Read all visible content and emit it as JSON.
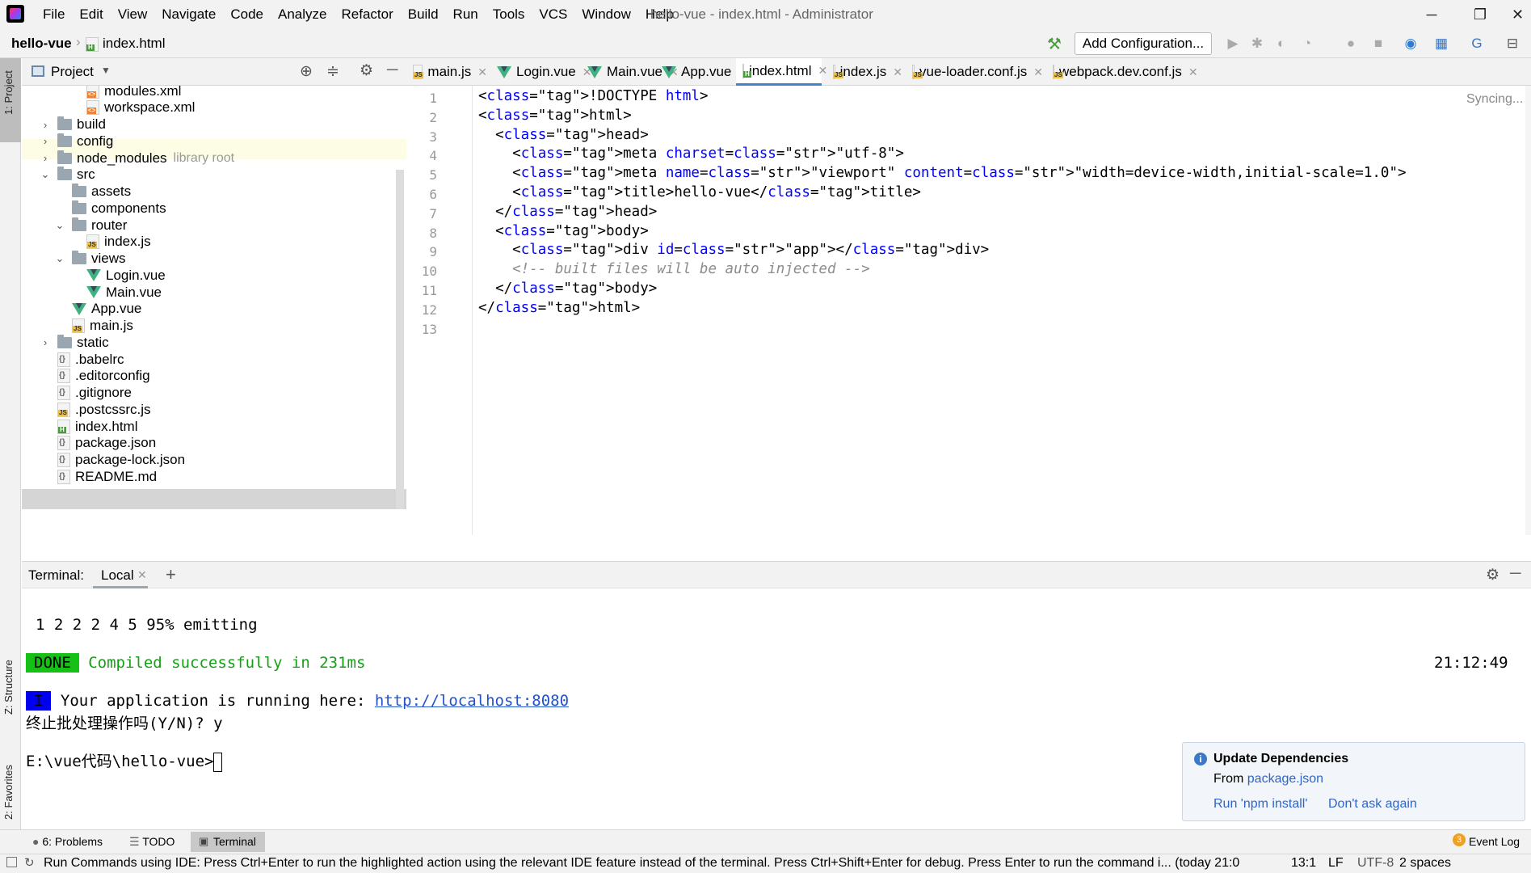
{
  "menubar": {
    "items": [
      "File",
      "Edit",
      "View",
      "Navigate",
      "Code",
      "Analyze",
      "Refactor",
      "Build",
      "Run",
      "Tools",
      "VCS",
      "Window",
      "Help"
    ],
    "window_title": "hello-vue - index.html - Administrator"
  },
  "navbar": {
    "project": "hello-vue",
    "file": "index.html",
    "add_configuration": "Add Configuration..."
  },
  "left_strip": {
    "project_tab": "1: Project",
    "structure_tab": "Z: Structure",
    "favorites_tab": "2: Favorites"
  },
  "project_panel": {
    "title": "Project",
    "tree": [
      {
        "label": "modules.xml",
        "type": "xml",
        "depth": 3,
        "arrow": ""
      },
      {
        "label": "workspace.xml",
        "type": "xml",
        "depth": 3,
        "arrow": ""
      },
      {
        "label": "build",
        "type": "folder",
        "depth": 1,
        "arrow": "›"
      },
      {
        "label": "config",
        "type": "folder",
        "depth": 1,
        "arrow": "›"
      },
      {
        "label": "node_modules",
        "type": "folder",
        "depth": 1,
        "arrow": "›",
        "note": "library root"
      },
      {
        "label": "src",
        "type": "folder",
        "depth": 1,
        "arrow": "⌄"
      },
      {
        "label": "assets",
        "type": "folder",
        "depth": 2,
        "arrow": ""
      },
      {
        "label": "components",
        "type": "folder",
        "depth": 2,
        "arrow": ""
      },
      {
        "label": "router",
        "type": "folder",
        "depth": 2,
        "arrow": "⌄"
      },
      {
        "label": "index.js",
        "type": "js",
        "depth": 3,
        "arrow": ""
      },
      {
        "label": "views",
        "type": "folder",
        "depth": 2,
        "arrow": "⌄"
      },
      {
        "label": "Login.vue",
        "type": "vue",
        "depth": 3,
        "arrow": ""
      },
      {
        "label": "Main.vue",
        "type": "vue",
        "depth": 3,
        "arrow": ""
      },
      {
        "label": "App.vue",
        "type": "vue",
        "depth": 2,
        "arrow": ""
      },
      {
        "label": "main.js",
        "type": "js",
        "depth": 2,
        "arrow": ""
      },
      {
        "label": "static",
        "type": "folder",
        "depth": 1,
        "arrow": "›"
      },
      {
        "label": ".babelrc",
        "type": "cfg",
        "depth": 1,
        "arrow": ""
      },
      {
        "label": ".editorconfig",
        "type": "cfg",
        "depth": 1,
        "arrow": ""
      },
      {
        "label": ".gitignore",
        "type": "cfg",
        "depth": 1,
        "arrow": ""
      },
      {
        "label": ".postcssrc.js",
        "type": "js",
        "depth": 1,
        "arrow": ""
      },
      {
        "label": "index.html",
        "type": "html",
        "depth": 1,
        "arrow": "",
        "selected": true
      },
      {
        "label": "package.json",
        "type": "cfg",
        "depth": 1,
        "arrow": ""
      },
      {
        "label": "package-lock.json",
        "type": "cfg",
        "depth": 1,
        "arrow": ""
      },
      {
        "label": "README.md",
        "type": "cfg",
        "depth": 1,
        "arrow": ""
      }
    ]
  },
  "tabs": [
    {
      "label": "main.js",
      "type": "js"
    },
    {
      "label": "Login.vue",
      "type": "vue"
    },
    {
      "label": "Main.vue",
      "type": "vue"
    },
    {
      "label": "App.vue",
      "type": "vue"
    },
    {
      "label": "index.html",
      "type": "html",
      "active": true
    },
    {
      "label": "index.js",
      "type": "js"
    },
    {
      "label": "vue-loader.conf.js",
      "type": "js"
    },
    {
      "label": "webpack.dev.conf.js",
      "type": "js"
    }
  ],
  "editor": {
    "syncing": "Syncing...",
    "lines": [
      "<!DOCTYPE html>",
      "<html>",
      "  <head>",
      "    <meta charset=\"utf-8\">",
      "    <meta name=\"viewport\" content=\"width=device-width,initial-scale=1.0\">",
      "    <title>hello-vue</title>",
      "  </head>",
      "  <body>",
      "    <div id=\"app\"></div>",
      "    <!-- built files will be auto injected -->",
      "  </body>",
      "</html>",
      ""
    ]
  },
  "terminal": {
    "label": "Terminal:",
    "tab": "Local",
    "line_emitting": "1 2 2 2 4 5 95% emitting",
    "done_badge": "DONE",
    "compiled": "Compiled successfully in 231ms",
    "time": "21:12:49",
    "i_badge": "I",
    "running_text": "Your application is running here: ",
    "running_url": "http://localhost:8080",
    "batch_prompt": "终止批处理操作吗(Y/N)? y",
    "prompt": "E:\\vue代码\\hello-vue>"
  },
  "notification": {
    "title": "Update Dependencies",
    "from_text": "From ",
    "from_link": "package.json",
    "action1": "Run 'npm install'",
    "action2": "Don't ask again"
  },
  "toolwindows": {
    "problems": "6: Problems",
    "todo": "TODO",
    "terminal": "Terminal",
    "event_log_count": "3",
    "event_log": "Event Log"
  },
  "statusbar": {
    "message": "Run Commands using IDE: Press Ctrl+Enter to run the highlighted action using the relevant IDE feature instead of the terminal. Press Ctrl+Shift+Enter for debug. Press Enter to run the command i... (today 21:0",
    "position": "13:1",
    "line_sep": "LF",
    "encoding": "UTF-8",
    "indent": "2 spaces"
  }
}
